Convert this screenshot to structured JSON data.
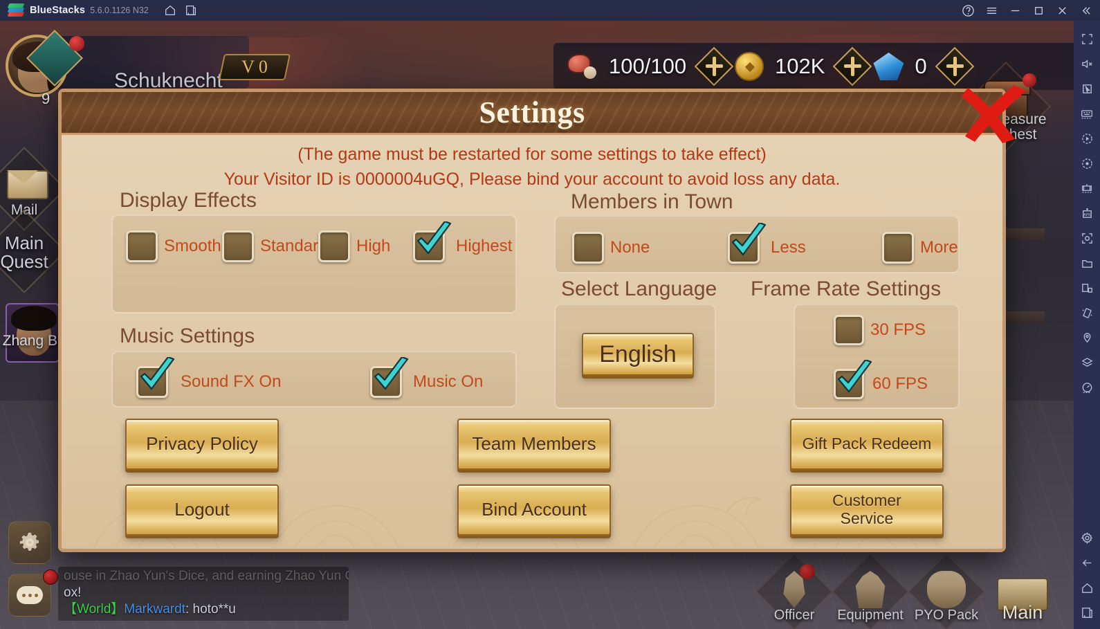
{
  "titlebar": {
    "app_name": "BlueStacks",
    "version": "5.6.0.1126 N32",
    "left_icons": [
      "home-icon",
      "multi-instance-icon"
    ],
    "right_icons": [
      "help-icon",
      "menu-icon",
      "minimize-icon",
      "maximize-icon",
      "close-icon",
      "collapse-icon"
    ]
  },
  "sidebar": {
    "icons": [
      "fullscreen-icon",
      "mute-icon",
      "cursor-icon",
      "keyboard-icon",
      "macro-play-icon",
      "macro-record-icon",
      "multi-instance-manager-icon",
      "install-apk-icon",
      "screenshot-icon",
      "media-folder-icon",
      "pip-icon",
      "shake-icon",
      "location-icon",
      "layers-icon",
      "meter-icon"
    ],
    "bottom_icons": [
      "gear-icon",
      "back-icon",
      "home-icon",
      "recents-icon"
    ]
  },
  "game": {
    "player": {
      "name": "Schuknecht",
      "level": "9",
      "vip": "V 0"
    },
    "resources": [
      {
        "icon": "meat-icon",
        "value": "100/100",
        "add": "+"
      },
      {
        "icon": "coin-icon",
        "value": "102K",
        "add": "+"
      },
      {
        "icon": "gem-icon",
        "value": "0",
        "add": "+"
      }
    ],
    "left_buttons": [
      {
        "name": "mail-button",
        "label": "Mail"
      },
      {
        "name": "main-quest-button",
        "label": "Main Quest"
      }
    ],
    "hero_card": {
      "label": "Zhang Bao"
    },
    "treasure_chest": {
      "label": "Treasure Chest"
    },
    "chat": {
      "line1": "ouse in Zhao Yun's Dice, and earning Zhao Yun Gift B",
      "line2": "ox!",
      "line3_tag": "【World】",
      "line3_user": "Markwardt",
      "line3_msg": ": hoto**u"
    },
    "bottom_nav": [
      {
        "name": "nav-officer",
        "label": "Officer",
        "icon": "helmet-icon",
        "badge": true
      },
      {
        "name": "nav-equipment",
        "label": "Equipment",
        "icon": "armor-icon",
        "badge": false
      },
      {
        "name": "nav-pyo-pack",
        "label": "PYO Pack",
        "icon": "sack-icon",
        "badge": false
      },
      {
        "name": "nav-main",
        "label": "Main",
        "icon": "scroll-icon",
        "badge": false
      }
    ],
    "side_buttons": [
      {
        "name": "settings-gear-button",
        "icon": "gear-icon"
      },
      {
        "name": "chat-button",
        "icon": "chat-bubble-icon"
      }
    ]
  },
  "settings": {
    "title": "Settings",
    "close_label": "X",
    "notice_restart": "(The game must be restarted for some settings to take effect)",
    "notice_visitor": "Your Visitor ID is 0000004uGQ, Please bind your account to avoid loss any data.",
    "display_effects": {
      "title": "Display Effects",
      "options": [
        {
          "label": "Smooth",
          "checked": false
        },
        {
          "label": "Standard",
          "checked": false
        },
        {
          "label": "High",
          "checked": false
        },
        {
          "label": "Highest",
          "checked": true
        }
      ]
    },
    "members_in_town": {
      "title": "Members in Town",
      "options": [
        {
          "label": "None",
          "checked": false
        },
        {
          "label": "Less",
          "checked": true
        },
        {
          "label": "More",
          "checked": false
        }
      ]
    },
    "music_settings": {
      "title": "Music Settings",
      "options": [
        {
          "label": "Sound FX On",
          "checked": true
        },
        {
          "label": "Music On",
          "checked": true
        }
      ]
    },
    "select_language": {
      "title": "Select Language",
      "selected": "English"
    },
    "frame_rate": {
      "title": "Frame Rate Settings",
      "options": [
        {
          "label": "30 FPS",
          "checked": false
        },
        {
          "label": "60 FPS",
          "checked": true
        }
      ]
    },
    "buttons": [
      {
        "name": "privacy-policy-button",
        "label": "Privacy Policy"
      },
      {
        "name": "team-members-button",
        "label": "Team Members"
      },
      {
        "name": "gift-pack-redeem-button",
        "label": "Gift Pack Redeem"
      },
      {
        "name": "logout-button",
        "label": "Logout"
      },
      {
        "name": "bind-account-button",
        "label": "Bind Account"
      },
      {
        "name": "customer-service-button",
        "label": "Customer Service"
      }
    ]
  },
  "colors": {
    "panel_bg": "#e2cdae",
    "panel_border": "#c2956a",
    "header_brown": "#7d4f2c",
    "notice_red": "#b03a16",
    "option_red": "#c1491c",
    "section_brown": "#7a4a32",
    "gold_button": "#e8c573",
    "check_teal": "#3fd3d0",
    "close_red": "#e01b14",
    "titlebar_bg": "#262b47",
    "sidebar_bg": "#2b3052"
  }
}
